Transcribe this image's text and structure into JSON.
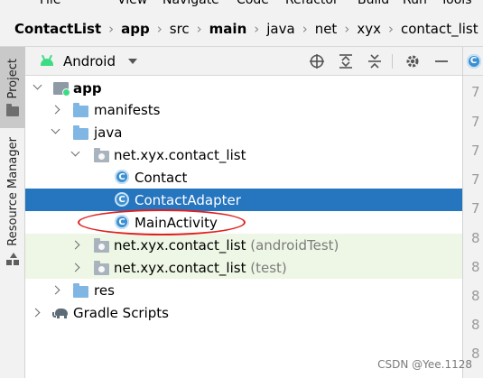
{
  "menu": [
    "File",
    "View",
    "Navigate",
    "Code",
    "Refactor",
    "Build",
    "Run",
    "Tools"
  ],
  "breadcrumb": [
    "ContactList",
    "app",
    "src",
    "main",
    "java",
    "net",
    "xyx",
    "contact_list"
  ],
  "breadcrumb_last_icon": "class-icon",
  "side_tabs": {
    "project": "Project",
    "resource_manager": "Resource Manager"
  },
  "panel": {
    "view_mode": "Android"
  },
  "tree": [
    {
      "label": "app",
      "suffix": ""
    },
    {
      "label": "manifests",
      "suffix": ""
    },
    {
      "label": "java",
      "suffix": ""
    },
    {
      "label": "net.xyx.contact_list",
      "suffix": ""
    },
    {
      "label": "Contact",
      "suffix": ""
    },
    {
      "label": "ContactAdapter",
      "suffix": ""
    },
    {
      "label": "MainActivity",
      "suffix": ""
    },
    {
      "label": "net.xyx.contact_list",
      "suffix": "(androidTest)"
    },
    {
      "label": "net.xyx.contact_list",
      "suffix": "(test)"
    },
    {
      "label": "res",
      "suffix": ""
    },
    {
      "label": "Gradle Scripts",
      "suffix": ""
    }
  ],
  "gutter_numbers": [
    "7",
    "7",
    "7",
    "7",
    "7",
    "8",
    "8",
    "8",
    "8",
    "8",
    "8"
  ],
  "class_icon_glyph": "C",
  "colors": {
    "selection": "#2675bf",
    "annotation": "#e02020",
    "class_icon": "#3d8fd1",
    "folder": "#7fb6e3",
    "test_row": "#eef7e6"
  },
  "watermark": "CSDN @Yee.1128"
}
